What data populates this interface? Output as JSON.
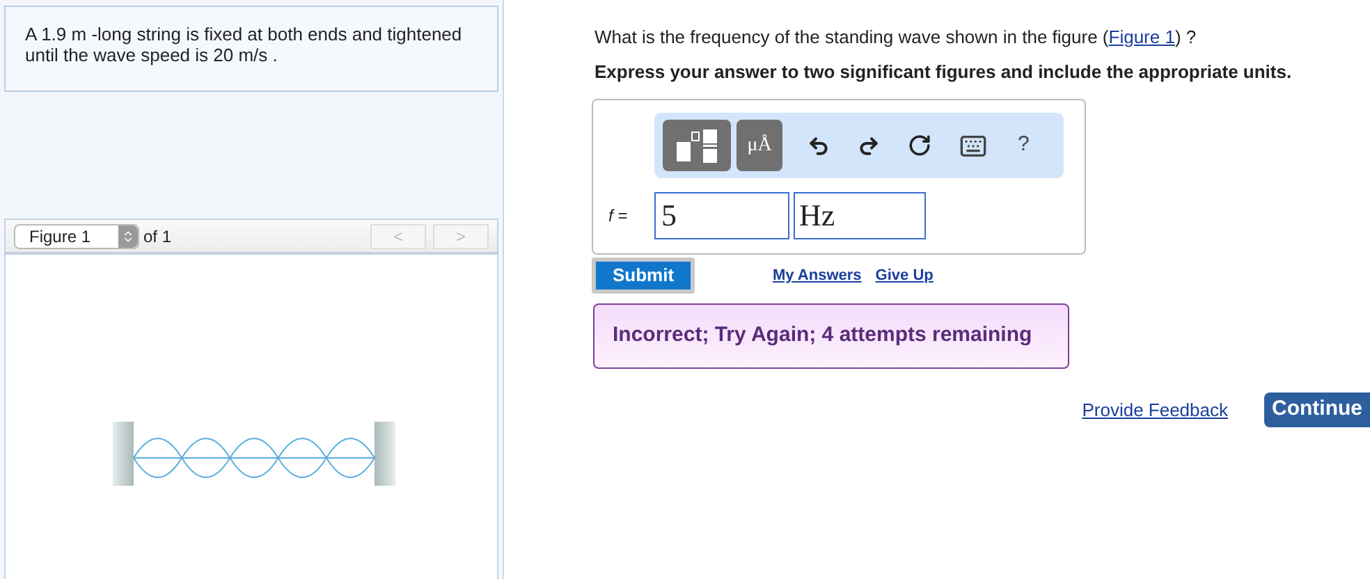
{
  "problem": {
    "text": "A 1.9 m -long string is fixed at both ends and tightened until the wave speed is 20 m/s ."
  },
  "figure_nav": {
    "select": "Figure 1",
    "of": "of 1",
    "prev": "<",
    "next": ">"
  },
  "question": {
    "text": "What is the frequency of the standing wave shown in the figure (",
    "link": "Figure 1",
    "after": ") ?",
    "instruction": "Express your answer to two significant figures and include the appropriate units."
  },
  "toolbar": {
    "units_label": "μÅ",
    "help": "?"
  },
  "answer": {
    "label": "f =",
    "value": "5",
    "unit": "Hz"
  },
  "submit": "Submit",
  "links": [
    "My Answers",
    "Give Up"
  ],
  "feedback": "Incorrect; Try Again; 4 attempts remaining",
  "provide_feedback": "Provide Feedback",
  "continue": "Continue"
}
